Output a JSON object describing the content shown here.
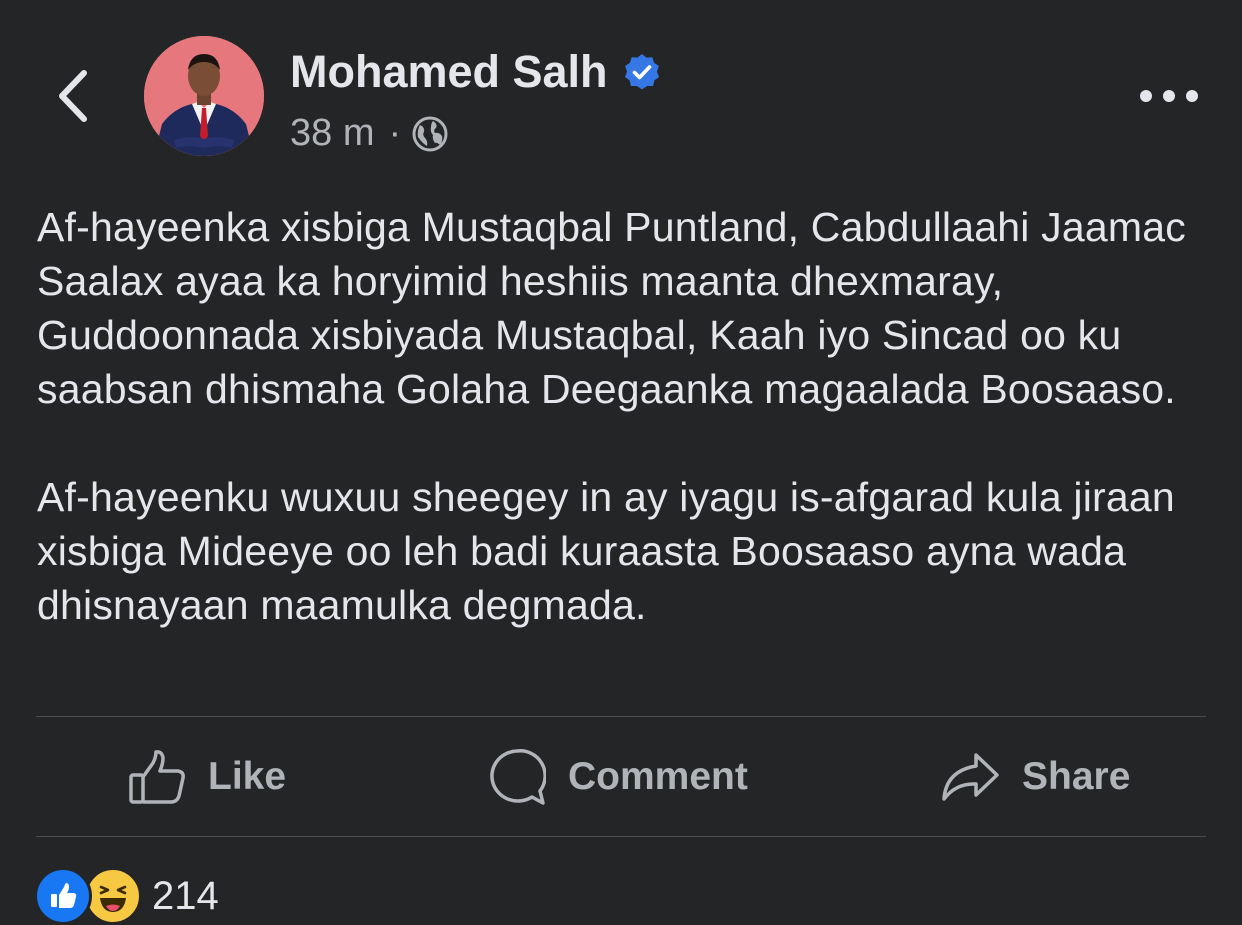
{
  "author": {
    "name": "Mohamed Salh",
    "verified": true,
    "time": "38 m",
    "separator": "·",
    "audience_icon": "globe-icon"
  },
  "post": {
    "paragraphs": [
      "Af-hayeenka xisbiga Mustaqbal Puntland, Cabdullaahi Jaamac Saalax ayaa ka horyimid heshiis maanta dhexmaray, Guddoonnada xisbiyada Mustaqbal, Kaah iyo Sincad oo ku saabsan dhismaha Golaha Deegaanka magaalada Boosaaso.",
      "Af-hayeenku wuxuu sheegey in ay iyagu is-afgarad kula jiraan xisbiga Mideeye oo leh badi kuraasta Boosaaso ayna wada dhisnayaan maamulka degmada."
    ]
  },
  "actions": {
    "like": "Like",
    "comment": "Comment",
    "share": "Share"
  },
  "reactions": {
    "types": [
      "like",
      "haha"
    ],
    "count": "214"
  },
  "colors": {
    "background": "#242526",
    "primary_text": "#e4e6eb",
    "secondary_text": "#b0b3b8",
    "verified_blue": "#1877f2",
    "divider": "#4a4c4f"
  }
}
